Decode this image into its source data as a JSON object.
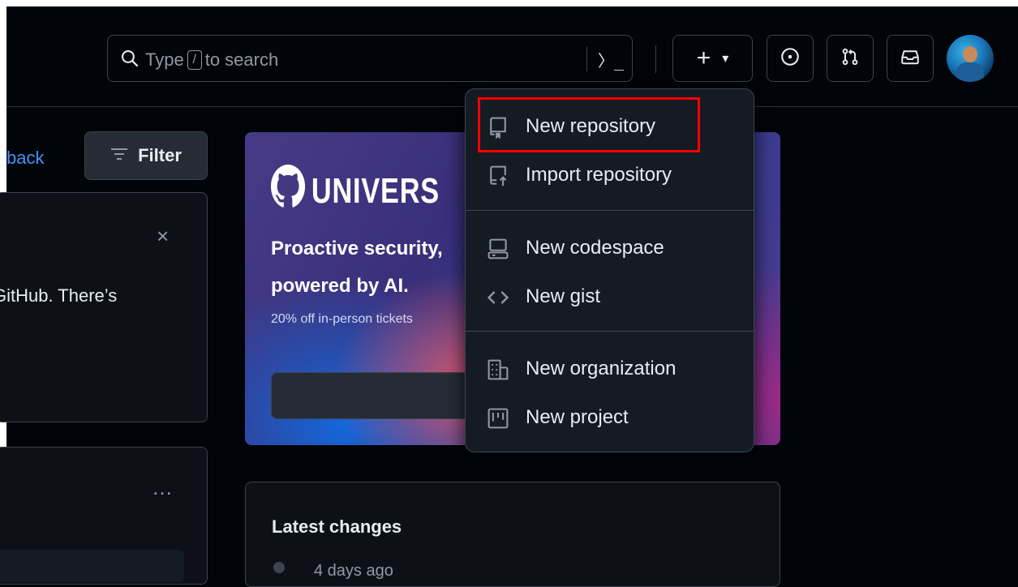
{
  "search": {
    "placeholder_before": "Type",
    "shortcut_key": "/",
    "placeholder_after": "to search",
    "command_palette_glyph": "〉_"
  },
  "header_buttons": {
    "create_plus": "+",
    "create_caret": "▾"
  },
  "left": {
    "feedback_link": "back",
    "filter_label": "Filter",
    "card1_text": "GitHub. There’s",
    "card1_close": "×",
    "card2_menu": "…"
  },
  "promo": {
    "brand": "UNIVERS",
    "headline_1": "Proactive security,",
    "headline_2": "powered by AI.",
    "subline": "20% off in-person tickets"
  },
  "latest_changes": {
    "title": "Latest changes",
    "first_time": "4 days ago"
  },
  "create_menu": {
    "items": [
      {
        "label": "New repository",
        "icon": "repo-icon"
      },
      {
        "label": "Import repository",
        "icon": "repo-push-icon"
      },
      {
        "label": "New codespace",
        "icon": "codespaces-icon"
      },
      {
        "label": "New gist",
        "icon": "code-icon"
      },
      {
        "label": "New organization",
        "icon": "organization-icon"
      },
      {
        "label": "New project",
        "icon": "project-icon"
      }
    ]
  },
  "colors": {
    "background": "#010409",
    "surface": "#0d1117",
    "menu_bg": "#151b23",
    "border": "#3d444d",
    "link": "#4493f8",
    "highlight": "#ff0000"
  }
}
